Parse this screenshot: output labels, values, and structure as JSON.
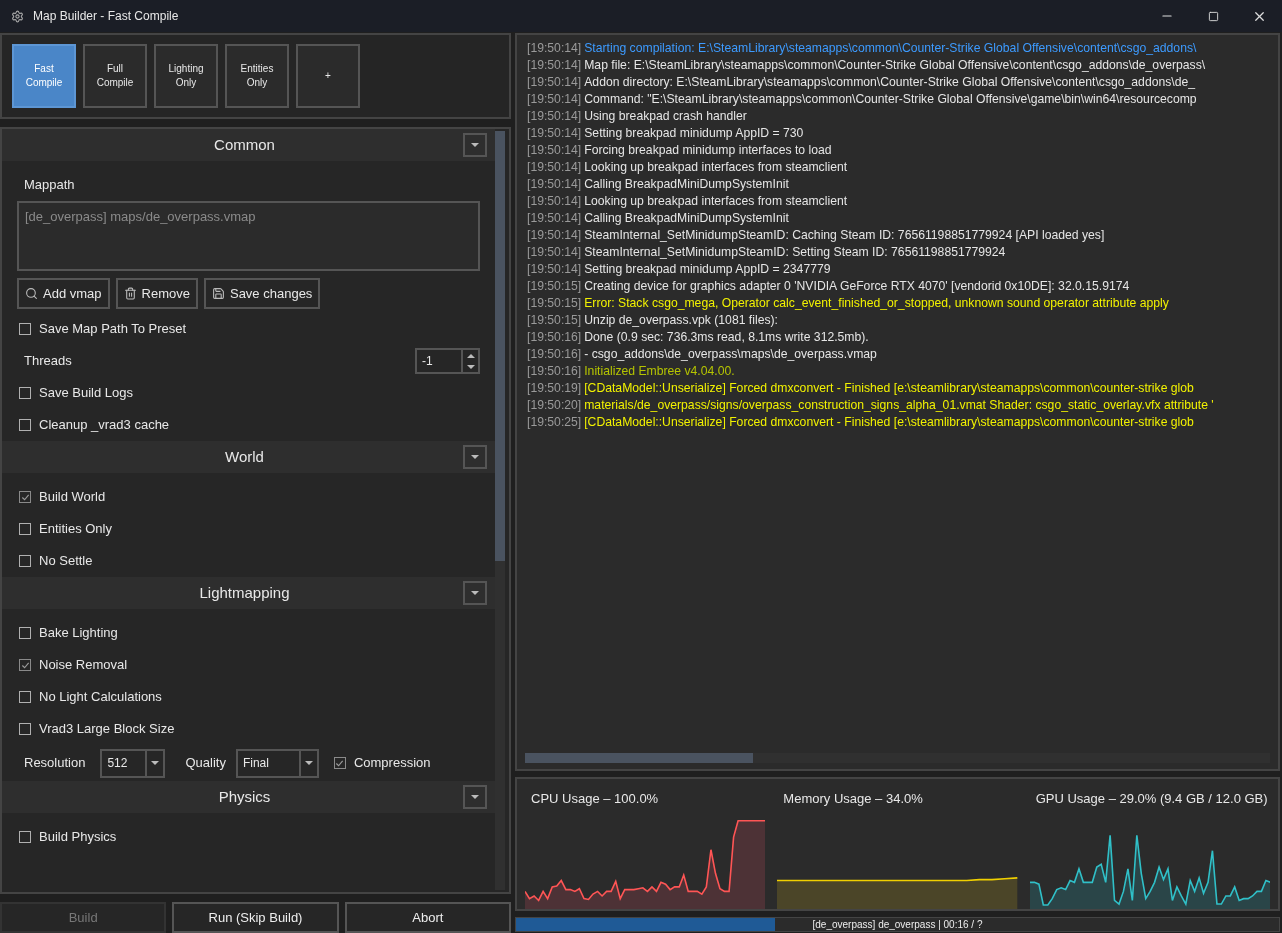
{
  "window": {
    "title": "Map Builder - Fast Compile"
  },
  "presets": [
    {
      "label": "Fast\nCompile",
      "selected": true
    },
    {
      "label": "Full\nCompile",
      "selected": false
    },
    {
      "label": "Lighting\nOnly",
      "selected": false
    },
    {
      "label": "Entities\nOnly",
      "selected": false
    },
    {
      "label": "+",
      "selected": false
    }
  ],
  "sections": [
    {
      "title": "Common",
      "expanded": true,
      "items": [
        {
          "kind": "label",
          "label": "Mappath"
        },
        {
          "kind": "list",
          "entries": [
            "[de_overpass] maps/de_overpass.vmap"
          ]
        },
        {
          "kind": "buttons",
          "buttons": [
            "Add vmap",
            "Remove",
            "Save changes"
          ]
        },
        {
          "kind": "checkbox",
          "label": "Save Map Path To Preset",
          "checked": false
        },
        {
          "kind": "spinner",
          "label": "Threads",
          "value": "-1"
        },
        {
          "kind": "checkbox",
          "label": "Save Build Logs",
          "checked": false
        },
        {
          "kind": "checkbox",
          "label": "Cleanup _vrad3 cache",
          "checked": false
        }
      ]
    },
    {
      "title": "World",
      "expanded": true,
      "items": [
        {
          "kind": "checkbox",
          "label": "Build World",
          "checked": true
        },
        {
          "kind": "checkbox",
          "label": "Entities Only",
          "checked": false
        },
        {
          "kind": "checkbox",
          "label": "No Settle",
          "checked": false
        }
      ]
    },
    {
      "title": "Lightmapping",
      "expanded": true,
      "items": [
        {
          "kind": "checkbox",
          "label": "Bake Lighting",
          "checked": false
        },
        {
          "kind": "checkbox",
          "label": "Noise Removal",
          "checked": true
        },
        {
          "kind": "checkbox",
          "label": "No Light Calculations",
          "checked": false
        },
        {
          "kind": "checkbox",
          "label": "Vrad3 Large Block Size",
          "checked": false
        },
        {
          "kind": "options",
          "resolution": {
            "label": "Resolution",
            "value": "512"
          },
          "quality": {
            "label": "Quality",
            "value": "Final"
          },
          "compression": {
            "label": "Compression",
            "checked": true
          }
        }
      ]
    },
    {
      "title": "Physics",
      "expanded": true,
      "items": [
        {
          "kind": "checkbox",
          "label": "Build Physics",
          "checked": false
        }
      ]
    }
  ],
  "actions": [
    {
      "label": "Build",
      "disabled": true
    },
    {
      "label": "Run (Skip Build)",
      "disabled": false
    },
    {
      "label": "Abort",
      "disabled": false
    }
  ],
  "log": [
    {
      "time": "[19:50:14]",
      "text": "Starting compilation: E:\\SteamLibrary\\steamapps\\common\\Counter-Strike Global Offensive\\content\\csgo_addons\\",
      "kind": "start"
    },
    {
      "time": "[19:50:14]",
      "text": "Map file: E:\\SteamLibrary\\steamapps\\common\\Counter-Strike Global Offensive\\content\\csgo_addons\\de_overpass\\",
      "kind": "info"
    },
    {
      "time": "[19:50:14]",
      "text": "Addon directory: E:\\SteamLibrary\\steamapps\\common\\Counter-Strike Global Offensive\\content\\csgo_addons\\de_",
      "kind": "info"
    },
    {
      "time": "[19:50:14]",
      "text": "Command: \"E:\\SteamLibrary\\steamapps\\common\\Counter-Strike Global Offensive\\game\\bin\\win64\\resourcecomp",
      "kind": "info"
    },
    {
      "time": "[19:50:14]",
      "text": "Using breakpad crash handler",
      "kind": "info"
    },
    {
      "time": "[19:50:14]",
      "text": "Setting breakpad minidump AppID = 730",
      "kind": "info"
    },
    {
      "time": "[19:50:14]",
      "text": "Forcing breakpad minidump interfaces to load",
      "kind": "info"
    },
    {
      "time": "[19:50:14]",
      "text": "Looking up breakpad interfaces from steamclient",
      "kind": "info"
    },
    {
      "time": "[19:50:14]",
      "text": "Calling BreakpadMiniDumpSystemInit",
      "kind": "info"
    },
    {
      "time": "[19:50:14]",
      "text": "Looking up breakpad interfaces from steamclient",
      "kind": "info"
    },
    {
      "time": "[19:50:14]",
      "text": "Calling BreakpadMiniDumpSystemInit",
      "kind": "info"
    },
    {
      "time": "[19:50:14]",
      "text": "SteamInternal_SetMinidumpSteamID: Caching Steam ID: 76561198851779924 [API loaded yes]",
      "kind": "info"
    },
    {
      "time": "[19:50:14]",
      "text": "SteamInternal_SetMinidumpSteamID: Setting Steam ID: 76561198851779924",
      "kind": "info"
    },
    {
      "time": "[19:50:14]",
      "text": "Setting breakpad minidump AppID = 2347779",
      "kind": "info"
    },
    {
      "time": "[19:50:15]",
      "text": "Creating device for graphics adapter 0 'NVIDIA GeForce RTX 4070' [vendorid 0x10DE]: 32.0.15.9174",
      "kind": "info"
    },
    {
      "time": "[19:50:15]",
      "text": "Error: Stack csgo_mega, Operator calc_event_finished_or_stopped, unknown sound operator attribute apply",
      "kind": "warning"
    },
    {
      "time": "[19:50:15]",
      "text": "Unzip de_overpass.vpk (1081 files):",
      "kind": "info"
    },
    {
      "time": "[19:50:16]",
      "text": "Done (0.9 sec: 736.3ms read, 8.1ms write 312.5mb).",
      "kind": "info"
    },
    {
      "time": "[19:50:16]",
      "text": "- csgo_addons\\de_overpass\\maps\\de_overpass.vmap",
      "kind": "info"
    },
    {
      "time": "[19:50:16]",
      "text": "Initialized Embree v4.04.00.",
      "kind": "success"
    },
    {
      "time": "[19:50:19]",
      "text": "[CDataModel::Unserialize] Forced dmxconvert - Finished [e:\\steamlibrary\\steamapps\\common\\counter-strike glob",
      "kind": "warning"
    },
    {
      "time": "[19:50:20]",
      "text": "materials/de_overpass/signs/overpass_construction_signs_alpha_01.vmat Shader: csgo_static_overlay.vfx attribute '",
      "kind": "warning"
    },
    {
      "time": "[19:50:25]",
      "text": "[CDataModel::Unserialize] Forced dmxconvert - Finished [e:\\steamlibrary\\steamapps\\common\\counter-strike glob",
      "kind": "warning"
    }
  ],
  "graphs": [
    {
      "title": "CPU Usage – 100.0%",
      "color": "#ff5555"
    },
    {
      "title": "Memory Usage – 34.0%",
      "color": "#f0d000"
    },
    {
      "title": "GPU Usage – 29.0% (9.4 GB / 12.0 GB)",
      "color": "#30c0c8"
    }
  ],
  "progress": {
    "level": 0.34,
    "text": "[de_overpass] de_overpass | 00:16 / ?"
  }
}
